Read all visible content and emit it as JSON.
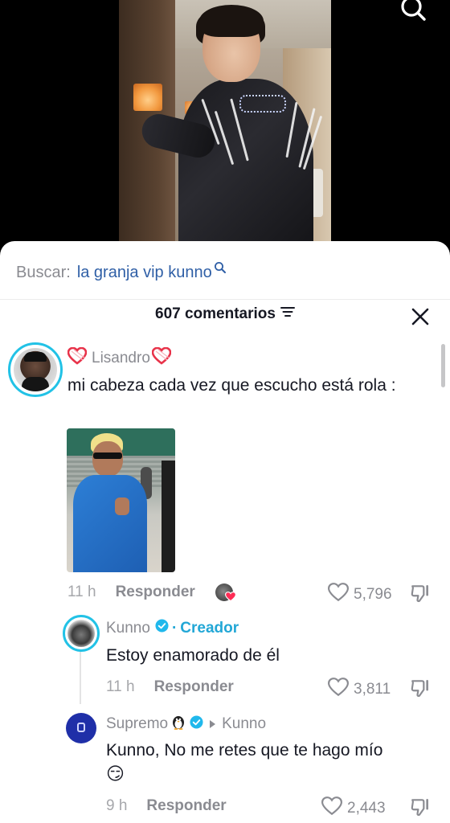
{
  "search": {
    "prefix": "Buscar:",
    "query": "la granja vip kunno"
  },
  "comments_header": {
    "count_label": "607 comentarios"
  },
  "comments": [
    {
      "username": "Lisandro",
      "text": "mi cabeza cada vez que escucho está rola :",
      "time": "11 h",
      "reply_label": "Responder",
      "likes": "5,796"
    }
  ],
  "replies": [
    {
      "username": "Kunno",
      "badge": "Creador",
      "badge_separator": "·",
      "text": "Estoy enamorado de él",
      "time": "11 h",
      "reply_label": "Responder",
      "likes": "3,811"
    },
    {
      "username": "Supremo",
      "reply_to": "Kunno",
      "text": "Kunno, No me retes que te hago mío",
      "emoji": "😏",
      "time": "9 h",
      "reply_label": "Responder",
      "likes": "2,443"
    }
  ],
  "colors": {
    "accent_link": "#2f5fa6",
    "creator": "#22a7d6",
    "text_primary": "#161823",
    "text_secondary": "#8a8b91",
    "verified": "#20b8ec",
    "heart_emoji": "#e8334a"
  },
  "icons": [
    "search-icon",
    "filter-icon",
    "close-icon",
    "heart-outline-icon",
    "dislike-icon",
    "verified-badge-icon",
    "heart-emoji-icon",
    "penguin-emoji-icon",
    "smirk-emoji-icon"
  ]
}
